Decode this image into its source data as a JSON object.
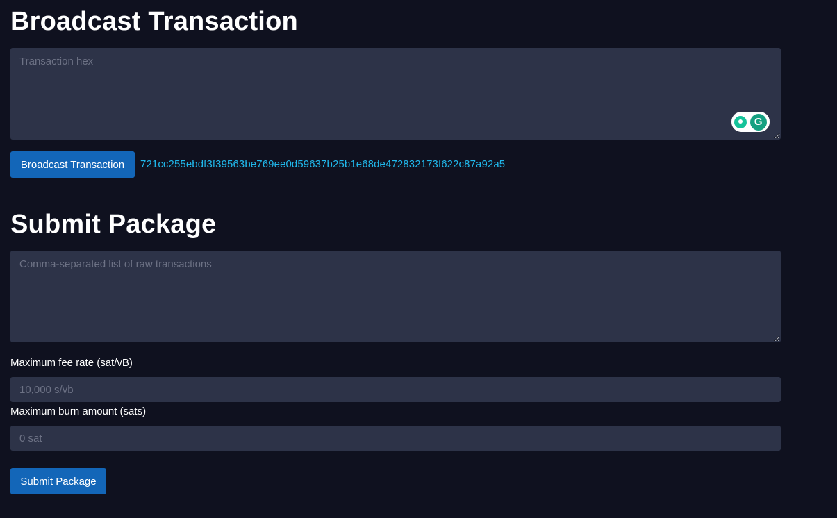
{
  "broadcast": {
    "title": "Broadcast Transaction",
    "textarea_placeholder": "Transaction hex",
    "button_label": "Broadcast Transaction",
    "txid": "721cc255ebdf3f39563be769ee0d59637b25b1e68de472832173f622c87a92a5"
  },
  "grammarly": {
    "logo_letter": "G"
  },
  "package": {
    "title": "Submit Package",
    "textarea_placeholder": "Comma-separated list of raw transactions",
    "fee_label": "Maximum fee rate (sat/vB)",
    "fee_placeholder": "10,000 s/vb",
    "burn_label": "Maximum burn amount (sats)",
    "burn_placeholder": "0 sat",
    "button_label": "Submit Package"
  },
  "colors": {
    "background": "#0f111f",
    "field": "#2d3348",
    "button": "#1366b8",
    "link": "#20b7ea"
  }
}
